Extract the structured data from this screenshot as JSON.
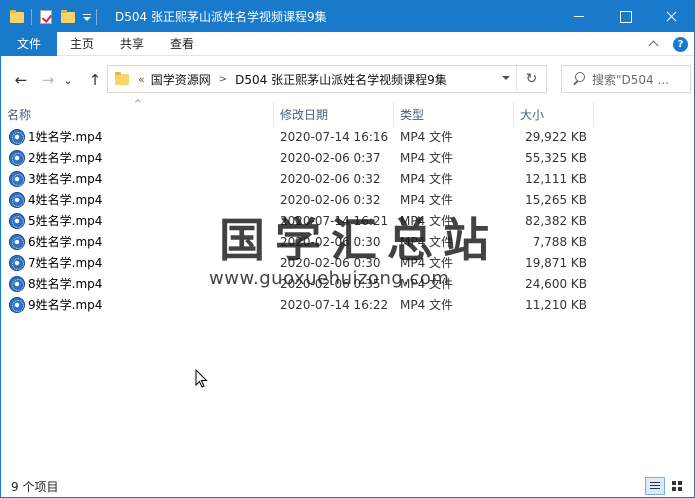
{
  "window": {
    "title": "D504 张正熙茅山派姓名学视频课程9集"
  },
  "ribbon": {
    "tabs": [
      "文件",
      "主页",
      "共享",
      "查看"
    ]
  },
  "nav": {
    "back": "←",
    "forward": "→",
    "recent": "⌄",
    "up": "↑",
    "address_prefix": "«",
    "crumbs": [
      "国学资源网",
      "D504 张正熙茅山派姓名学视频课程9集"
    ],
    "refresh": "↻",
    "search_placeholder": "搜索\"D504 ..."
  },
  "columns": {
    "name": "名称",
    "date": "修改日期",
    "type": "类型",
    "size": "大小"
  },
  "files": [
    {
      "name": "1姓名学.mp4",
      "date": "2020-07-14 16:16",
      "type": "MP4 文件",
      "size": "29,922 KB"
    },
    {
      "name": "2姓名学.mp4",
      "date": "2020-02-06 0:37",
      "type": "MP4 文件",
      "size": "55,325 KB"
    },
    {
      "name": "3姓名学.mp4",
      "date": "2020-02-06 0:32",
      "type": "MP4 文件",
      "size": "12,111 KB"
    },
    {
      "name": "4姓名学.mp4",
      "date": "2020-02-06 0:32",
      "type": "MP4 文件",
      "size": "15,265 KB"
    },
    {
      "name": "5姓名学.mp4",
      "date": "2020-07-14 16:21",
      "type": "MP4 文件",
      "size": "82,382 KB"
    },
    {
      "name": "6姓名学.mp4",
      "date": "2020-02-06 0:30",
      "type": "MP4 文件",
      "size": "7,788 KB"
    },
    {
      "name": "7姓名学.mp4",
      "date": "2020-02-06 0:30",
      "type": "MP4 文件",
      "size": "19,871 KB"
    },
    {
      "name": "8姓名学.mp4",
      "date": "2020-02-06 0:35",
      "type": "MP4 文件",
      "size": "24,600 KB"
    },
    {
      "name": "9姓名学.mp4",
      "date": "2020-07-14 16:22",
      "type": "MP4 文件",
      "size": "11,210 KB"
    }
  ],
  "watermark": {
    "title": "国学汇总站",
    "url": "www.guoxuehuizong.com"
  },
  "status": {
    "count": "9 个项目"
  },
  "colors": {
    "accent": "#1979ca",
    "header_text": "#4c607a"
  }
}
